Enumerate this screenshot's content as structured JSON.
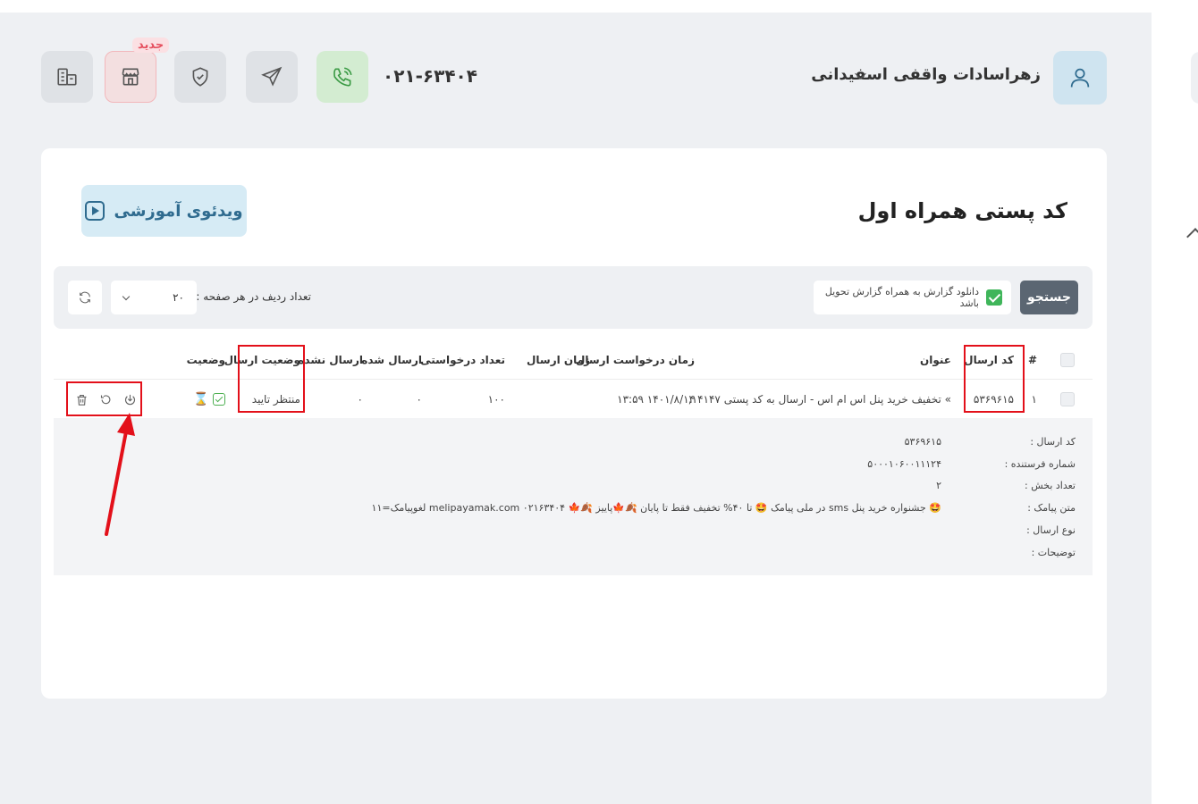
{
  "header": {
    "new_badge": "جدید",
    "phone": "۰۲۱-۶۳۴۰۴",
    "user_name": "زهراسادات واقفی اسفیدانی",
    "icons": [
      "building-icon",
      "shop-icon",
      "shield-check-icon",
      "send-icon",
      "phone-call-icon",
      "user-icon"
    ]
  },
  "page": {
    "title": "کد پستی همراه اول",
    "video_button": "ویدئوی آموزشی"
  },
  "filters": {
    "search_button": "جستجو",
    "download_report_label": "دانلود گزارش به همراه گزارش تحویل باشد",
    "download_report_checked": true,
    "rows_per_page_label": "تعداد ردیف در هر صفحه :",
    "rows_per_page_value": "۲۰"
  },
  "table": {
    "headers": {
      "index": "#",
      "send_code": "کد ارسال",
      "title": "عنوان",
      "request_time": "زمان درخواست ارسال",
      "send_time": "زمان ارسال",
      "requested_count": "تعداد درخواستی",
      "sent": "ارسال شده",
      "not_sent": "ارسال نشده",
      "send_status": "وضعیت ارسال",
      "status": "وضعیت"
    },
    "rows": [
      {
        "index": "۱",
        "send_code": "۵۳۶۹۶۱۵",
        "title": "» تخفیف خرید پنل اس ام اس - ارسال به کد پستی ۱۴۱۴۷,",
        "request_time": "۱۴۰۱/۸/۱۴ ۱۳:۵۹",
        "send_time": "",
        "requested_count": "۱۰۰",
        "sent": "۰",
        "not_sent": "۰",
        "send_status": "منتظر تایید"
      }
    ]
  },
  "detail": {
    "labels": {
      "send_code": "کد ارسال :",
      "sender_number": "شماره فرستنده :",
      "parts": "تعداد بخش :",
      "message_text": "متن پیامک :",
      "send_type": "نوع ارسال :",
      "description": "توضیحات :"
    },
    "values": {
      "send_code": "۵۳۶۹۶۱۵",
      "sender_number": "۵۰۰۰۱۰۶۰۰۱۱۱۲۴",
      "parts": "۲",
      "message_text": "🤩 جشنواره خرید پنل sms در ملی پیامک 🤩 تا ۴۰% تخفیف فقط تا پایان 🍂🍁پاییز 🍂🍁 ۰۲۱۶۳۴۰۴ melipayamak.com لغوپیامک=۱۱",
      "send_type": "",
      "description": ""
    }
  },
  "colors": {
    "highlight": "#e3101a",
    "accent_blue": "#2f6b8f",
    "success": "#3fb55a"
  }
}
